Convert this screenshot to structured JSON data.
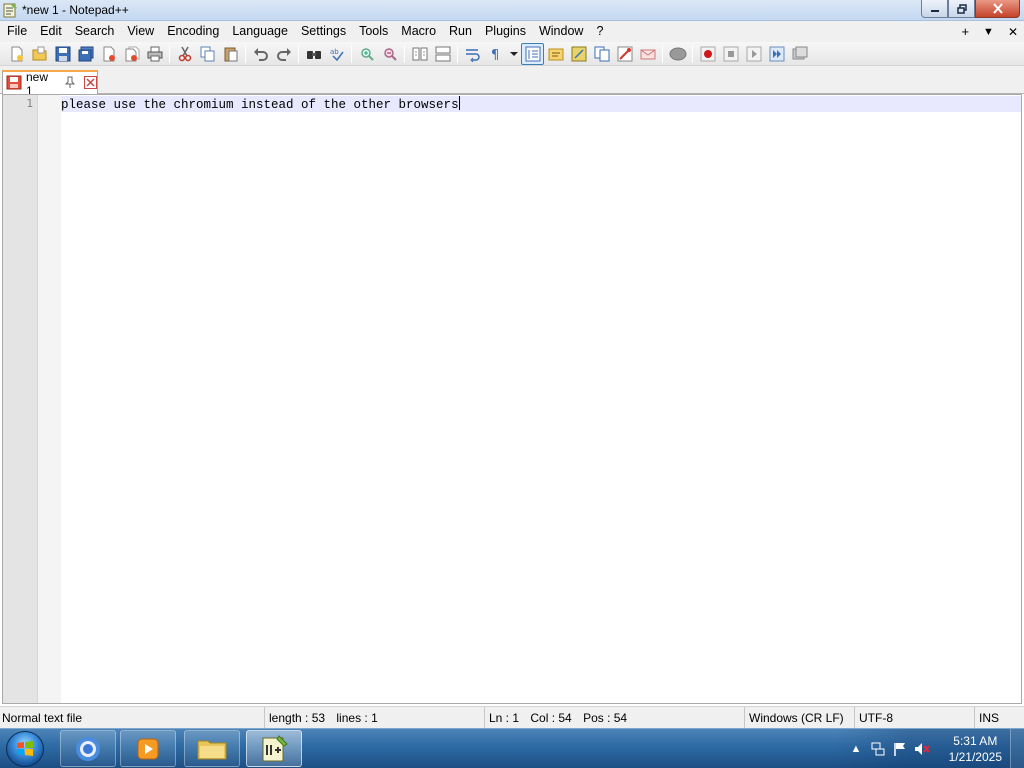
{
  "window": {
    "title": "*new 1 - Notepad++",
    "controls": {
      "minimize": "minimize",
      "maximize": "restore",
      "close": "close"
    }
  },
  "menu": {
    "items": [
      "File",
      "Edit",
      "Search",
      "View",
      "Encoding",
      "Language",
      "Settings",
      "Tools",
      "Macro",
      "Run",
      "Plugins",
      "Window",
      "?"
    ],
    "right": {
      "add": "+",
      "dropdown": "▼",
      "close": "✕"
    }
  },
  "toolbar": {
    "buttons": [
      "new-file-icon",
      "open-file-icon",
      "save-icon",
      "save-all-icon",
      "close-icon",
      "close-all-icon",
      "print-icon",
      "cut-icon",
      "copy-icon",
      "paste-icon",
      "undo-icon",
      "redo-icon",
      "find-icon",
      "replace-icon",
      "zoom-in-icon",
      "zoom-out-icon",
      "sync-vertical-icon",
      "sync-horizontal-icon",
      "word-wrap-icon",
      "show-all-chars-icon",
      "indent-guide-icon",
      "user-language-icon",
      "document-map-icon",
      "function-list-icon",
      "folder-workspace-icon",
      "monitoring-icon",
      "record-macro-icon",
      "stop-macro-icon",
      "play-macro-icon",
      "run-macro-multiple-icon",
      "save-macro-icon"
    ]
  },
  "tabs": [
    {
      "label": "new 1",
      "modified": true,
      "active": true
    }
  ],
  "editor": {
    "lines": [
      {
        "number": "1",
        "text": "please use the chromium instead of the other browsers"
      }
    ]
  },
  "statusbar": {
    "file_type": "Normal text file",
    "length": "length : 53",
    "lines": "lines : 1",
    "ln": "Ln : 1",
    "col": "Col : 54",
    "pos": "Pos : 54",
    "eol": "Windows (CR LF)",
    "encoding": "UTF-8",
    "mode": "INS"
  },
  "taskbar": {
    "pinned": [
      "chrome-icon",
      "media-player-icon",
      "file-explorer-icon",
      "notepad-plus-plus-icon"
    ],
    "active_app": "notepad-plus-plus-icon",
    "tray": {
      "show_hidden": "▲",
      "time": "5:31 AM",
      "date": "1/21/2025"
    }
  },
  "colors": {
    "tab_accent": "#f3a64a",
    "current_line": "#e8e8ff",
    "gutter": "#e4e4e4",
    "taskbar": "#2d6aa3"
  }
}
